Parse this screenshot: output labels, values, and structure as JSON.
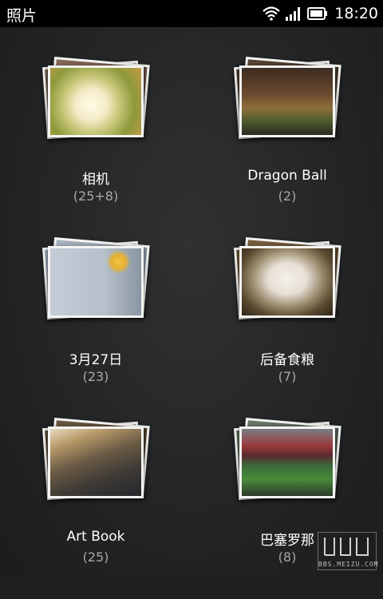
{
  "status_bar": {
    "app_title": "照片",
    "time": "18:20",
    "icons": [
      "wifi-icon",
      "signal-icon",
      "battery-icon"
    ]
  },
  "albums": [
    {
      "name": "相机",
      "count": "(25+8)",
      "thumb": "flower-photo"
    },
    {
      "name": "Dragon Ball",
      "count": "(2)",
      "thumb": "figurines-photo"
    },
    {
      "name": "3月27日",
      "count": "(23)",
      "thumb": "screen-photo"
    },
    {
      "name": "后备食粮",
      "count": "(7)",
      "thumb": "rabbit-photo"
    },
    {
      "name": "Art Book",
      "count": "(25)",
      "thumb": "book-photo"
    },
    {
      "name": "巴塞罗那",
      "count": "(8)",
      "thumb": "stadium-photo"
    }
  ],
  "watermark": {
    "text": "BBS.MEIZU.COM"
  },
  "colors": {
    "background": "#1e1f21",
    "count_text": "#a6a8aa",
    "status_bar": "#000000"
  }
}
